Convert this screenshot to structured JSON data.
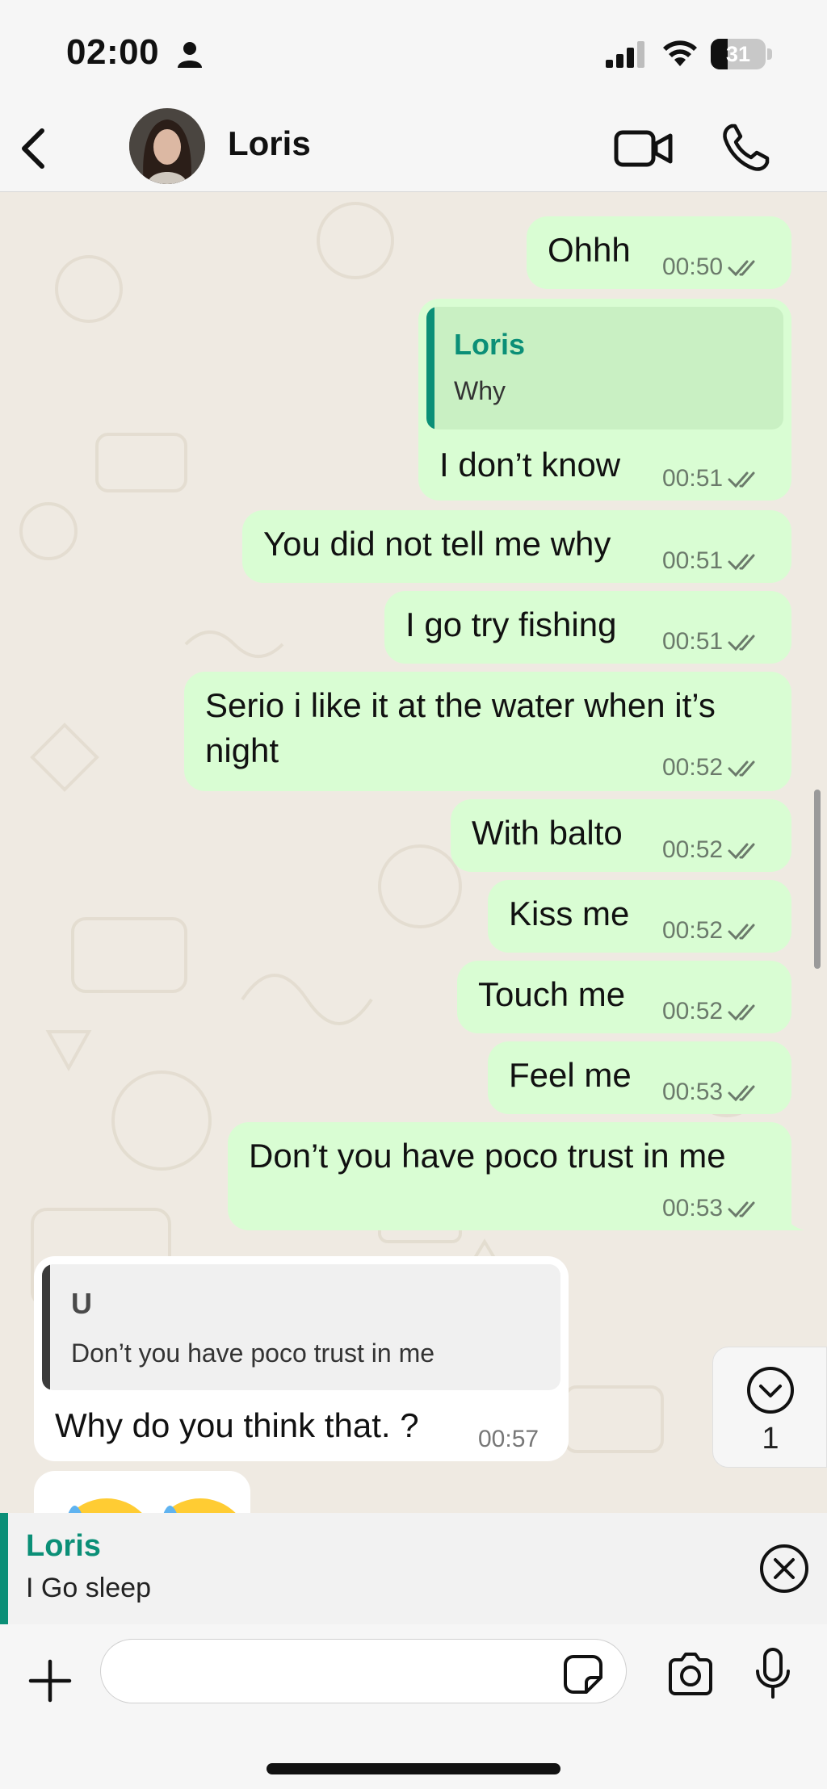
{
  "status_bar": {
    "time": "02:00",
    "battery": "31",
    "battery_level": 0.31
  },
  "header": {
    "contact_name": "Loris",
    "icons": [
      "back-arrow-icon",
      "video-camera-icon",
      "phone-icon"
    ]
  },
  "messages": [
    {
      "text": "Ohhh",
      "time": "00:50",
      "direction": "out",
      "read": true
    },
    {
      "text": "I don’t know",
      "time": "00:51",
      "direction": "out",
      "read": true,
      "quote": {
        "author": "Loris",
        "text": "Why"
      }
    },
    {
      "text": "You did not tell me why",
      "time": "00:51",
      "direction": "out",
      "read": true
    },
    {
      "text": "I go try fishing",
      "time": "00:51",
      "direction": "out",
      "read": true
    },
    {
      "text_line1": "Serio i like it at the water when it’s",
      "text_line2": "night",
      "time": "00:52",
      "direction": "out",
      "read": true
    },
    {
      "text": "With balto",
      "time": "00:52",
      "direction": "out",
      "read": true
    },
    {
      "text": "Kiss me",
      "time": "00:52",
      "direction": "out",
      "read": true
    },
    {
      "text": "Touch me",
      "time": "00:52",
      "direction": "out",
      "read": true
    },
    {
      "text": "Feel me",
      "time": "00:53",
      "direction": "out",
      "read": true
    },
    {
      "text": "Don’t you have poco trust in me",
      "time": "00:53",
      "direction": "out",
      "read": true
    },
    {
      "text": "Why do you think that. ?",
      "time": "00:57",
      "direction": "in",
      "quote": {
        "author": "U",
        "text": "Don’t you have poco trust in me"
      }
    }
  ],
  "scroll_down": {
    "unread_count": "1"
  },
  "reply_preview": {
    "author": "Loris",
    "text": "I Go sleep"
  },
  "composer": {
    "placeholder": "",
    "value": ""
  },
  "colors": {
    "outgoing_bubble": "#d9fdd3",
    "incoming_bubble": "#ffffff",
    "accent": "#0b8f77",
    "background": "#efeae2"
  }
}
